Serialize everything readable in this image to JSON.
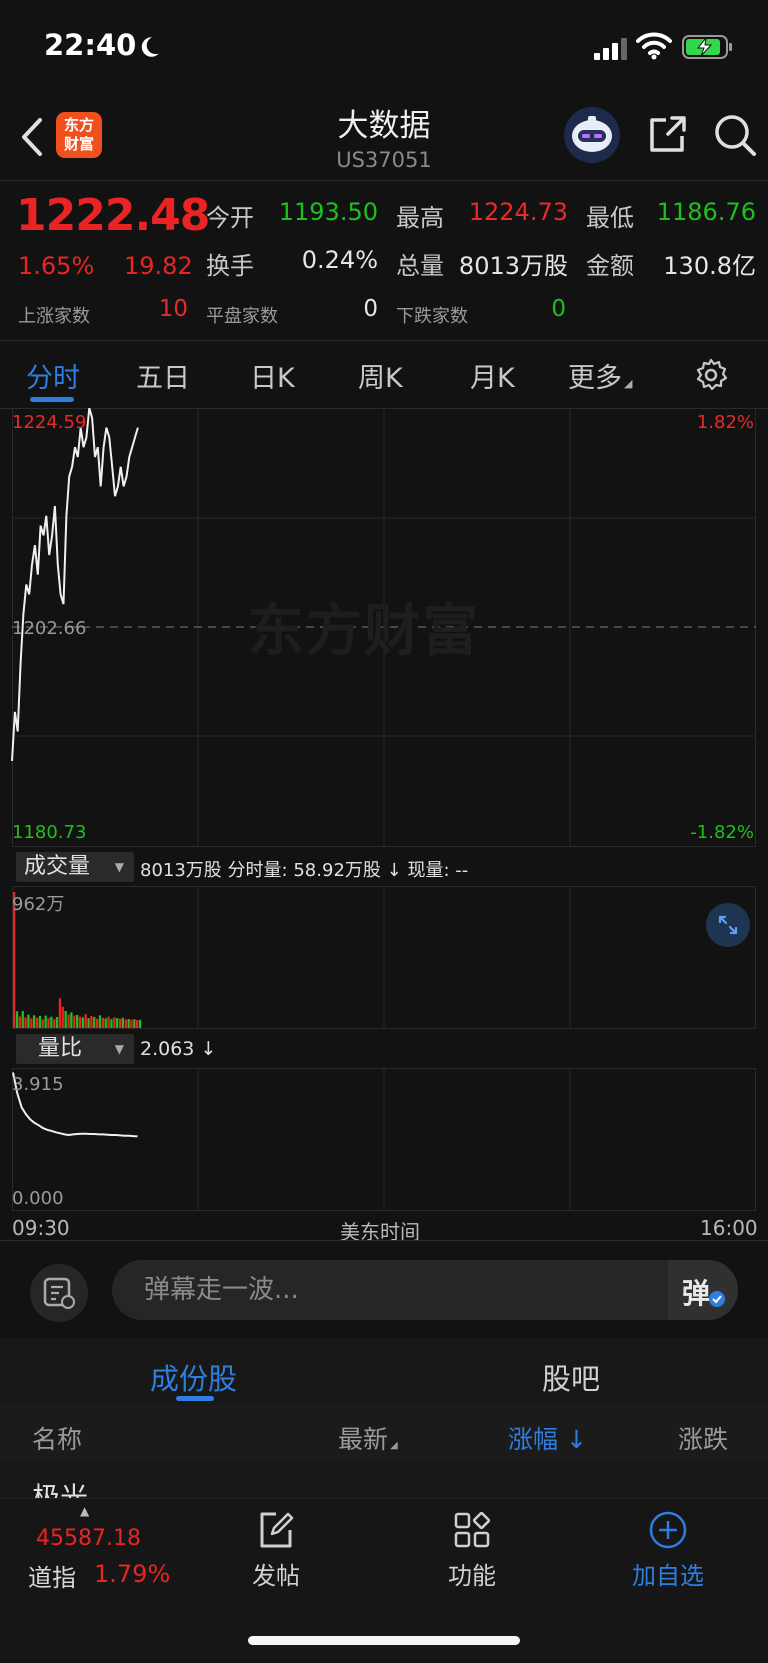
{
  "status_bar": {
    "time": "22:40"
  },
  "header": {
    "title": "大数据",
    "code": "US37051",
    "logo_text_line1": "东方",
    "logo_text_line2": "财富"
  },
  "quote": {
    "price": "1222.48",
    "change_pct": "1.65%",
    "change": "19.82",
    "rows": [
      {
        "l1": "今开",
        "v1": "1193.50",
        "l2": "最高",
        "v2": "1224.73",
        "l3": "最低",
        "v3": "1186.76"
      },
      {
        "l1": "换手",
        "v1": "0.24%",
        "l2": "总量",
        "v2": "8013万股",
        "l3": "金额",
        "v3": "130.8亿"
      }
    ],
    "breadth": {
      "up_label": "上涨家数",
      "up": "10",
      "flat_label": "平盘家数",
      "flat": "0",
      "down_label": "下跌家数",
      "down": "0"
    }
  },
  "tabs": [
    "分时",
    "五日",
    "日K",
    "周K",
    "月K",
    "更多"
  ],
  "chart_data": [
    {
      "type": "line",
      "title": "",
      "x_start_label": "09:30",
      "x_mid_label": "美东时间",
      "x_end_label": "16:00",
      "y_top": "1224.59",
      "y_mid": "1202.66",
      "y_bottom": "1180.73",
      "pct_top": "1.82%",
      "pct_bottom": "-1.82%",
      "ylim": [
        1180.73,
        1224.59
      ],
      "reference": 1202.66,
      "values": [
        1189,
        1194,
        1192,
        1199,
        1204,
        1207,
        1206,
        1209,
        1211,
        1208,
        1213,
        1212,
        1214,
        1210,
        1212,
        1215,
        1209,
        1206,
        1205,
        1214,
        1218,
        1219,
        1221,
        1220,
        1223,
        1221,
        1222,
        1225,
        1224,
        1220,
        1221,
        1217,
        1221,
        1223,
        1222,
        1219,
        1216,
        1217,
        1219,
        1217,
        1218,
        1220,
        1221,
        1222,
        1223
      ]
    },
    {
      "type": "bar",
      "title": "成交量",
      "total": "8013万股",
      "minute_vol_label": "分时量:",
      "minute_vol": "58.92万股",
      "arrow": "↓",
      "cur_vol_label": "现量:",
      "cur_vol": "--",
      "y_top_label": "962万",
      "ylim": [
        0,
        962
      ],
      "values": [
        962,
        118,
        82,
        120,
        75,
        95,
        68,
        90,
        72,
        85,
        60,
        88,
        70,
        80,
        62,
        78,
        210,
        150,
        120,
        95,
        110,
        88,
        92,
        80,
        75,
        98,
        70,
        86,
        78,
        65,
        90,
        72,
        68,
        80,
        62,
        75,
        70,
        66,
        72,
        60,
        64,
        58,
        62,
        56,
        58
      ],
      "up": [
        true,
        false,
        true,
        false,
        true,
        false,
        true,
        false,
        true,
        false,
        true,
        false,
        true,
        false,
        true,
        false,
        true,
        true,
        false,
        true,
        false,
        true,
        false,
        true,
        false,
        true,
        false,
        true,
        false,
        true,
        false,
        true,
        false,
        true,
        false,
        true,
        false,
        true,
        false,
        true,
        false,
        true,
        false,
        true,
        false
      ]
    },
    {
      "type": "line",
      "title": "量比",
      "value": "2.063",
      "arrow": "↓",
      "y_top_label": "3.915",
      "y_bottom_label": "0.000",
      "ylim": [
        0,
        3.915
      ],
      "values": [
        3.9,
        3.3,
        2.9,
        2.7,
        2.55,
        2.45,
        2.38,
        2.3,
        2.25,
        2.22,
        2.18,
        2.15,
        2.12,
        2.1,
        2.12,
        2.13,
        2.14,
        2.14,
        2.13,
        2.13,
        2.12,
        2.12,
        2.11,
        2.1,
        2.1,
        2.09,
        2.08,
        2.08,
        2.07,
        2.06
      ]
    }
  ],
  "danmu": {
    "placeholder": "弹幕走一波...",
    "button": "弹"
  },
  "sub_tabs": [
    "成份股",
    "股吧"
  ],
  "table_headers": {
    "name": "名称",
    "latest": "最新",
    "change_pct": "涨幅",
    "change": "涨跌"
  },
  "partial_row": "极光",
  "bottom": {
    "index_value": "45587.18",
    "index_name": "道指",
    "index_pct": "1.79%",
    "nav": [
      "发帖",
      "功能",
      "加自选"
    ]
  },
  "colors": {
    "up": "#ea2424",
    "down": "#1dc01d",
    "accent": "#2e7ee0",
    "bg": "#121212"
  }
}
